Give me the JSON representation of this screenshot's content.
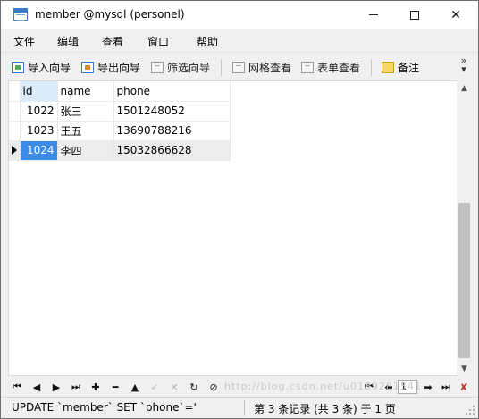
{
  "window": {
    "title": "member @mysql (personel)"
  },
  "menu": [
    "文件",
    "编辑",
    "查看",
    "窗口",
    "帮助"
  ],
  "toolbar": {
    "import_wizard": "导入向导",
    "export_wizard": "导出向导",
    "filter_wizard": "筛选向导",
    "grid_view": "网格查看",
    "form_view": "表单查看",
    "memo": "备注"
  },
  "grid": {
    "columns": [
      "id",
      "name",
      "phone"
    ],
    "rows": [
      {
        "id": "1022",
        "name": "张三",
        "phone": "1501248052"
      },
      {
        "id": "1023",
        "name": "王五",
        "phone": "13690788216"
      },
      {
        "id": "1024",
        "name": "李四",
        "phone": "15032866628"
      }
    ],
    "current_row_index": 2
  },
  "navigator": {
    "page_value": "1",
    "watermark": "http://blog.csdn.net/u0189281541"
  },
  "status": {
    "sql": "UPDATE `member` SET `phone`='",
    "record_info": "第 3 条记录 (共 3 条) 于 1 页"
  },
  "colors": {
    "selection": "#3c8ce6",
    "id_header": "#dcebfa",
    "current_row": "#ececec"
  }
}
